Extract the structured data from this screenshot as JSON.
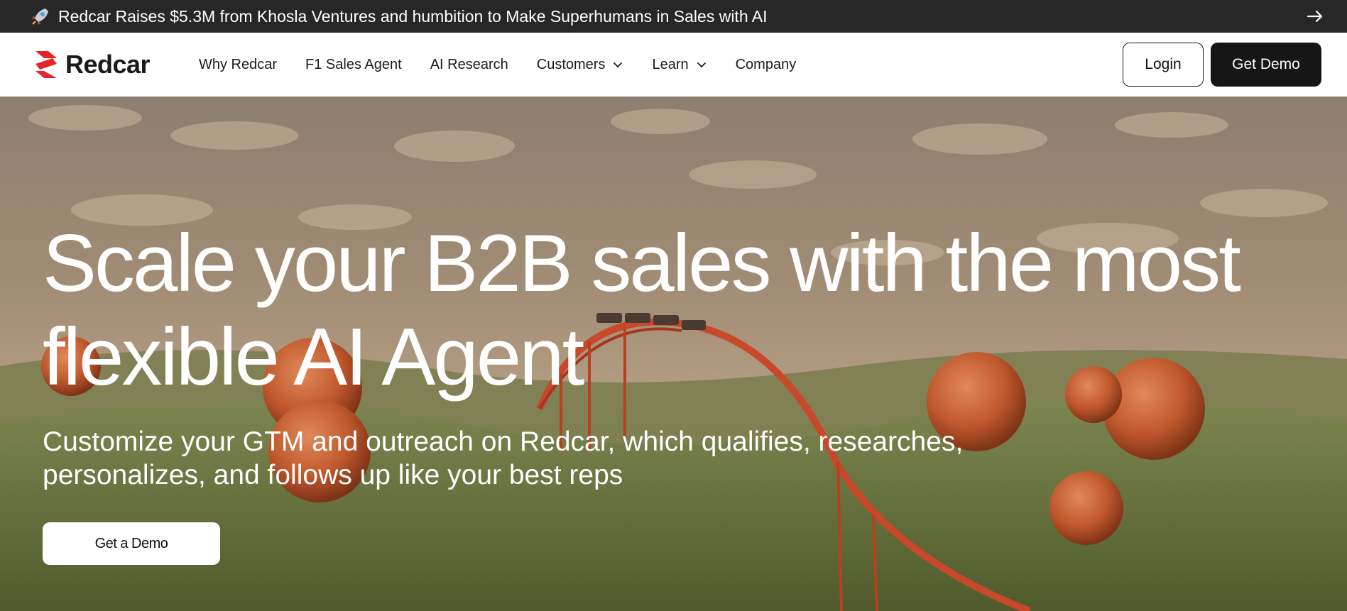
{
  "announcement": {
    "icon": "rocket-icon",
    "text": "Redcar Raises $5.3M from Khosla Ventures and humbition to Make Superhumans in Sales with AI",
    "arrow_icon": "arrow-right-icon"
  },
  "nav": {
    "logo_text": "Redcar",
    "brand_color": "#e8242b",
    "items": [
      {
        "label": "Why Redcar",
        "has_dropdown": false
      },
      {
        "label": "F1 Sales Agent",
        "has_dropdown": false
      },
      {
        "label": "AI Research",
        "has_dropdown": false
      },
      {
        "label": "Customers",
        "has_dropdown": true
      },
      {
        "label": "Learn",
        "has_dropdown": true
      },
      {
        "label": "Company",
        "has_dropdown": false
      }
    ],
    "login_label": "Login",
    "demo_label": "Get Demo"
  },
  "hero": {
    "headline_line1": "Scale your B2B sales with the most",
    "headline_line2": "flexible AI Agent",
    "subline_line1": "Customize your GTM and outreach on Redcar, which qualifies, researches,",
    "subline_line2": "personalizes, and follows up like your best reps",
    "cta_label": "Get a Demo"
  }
}
